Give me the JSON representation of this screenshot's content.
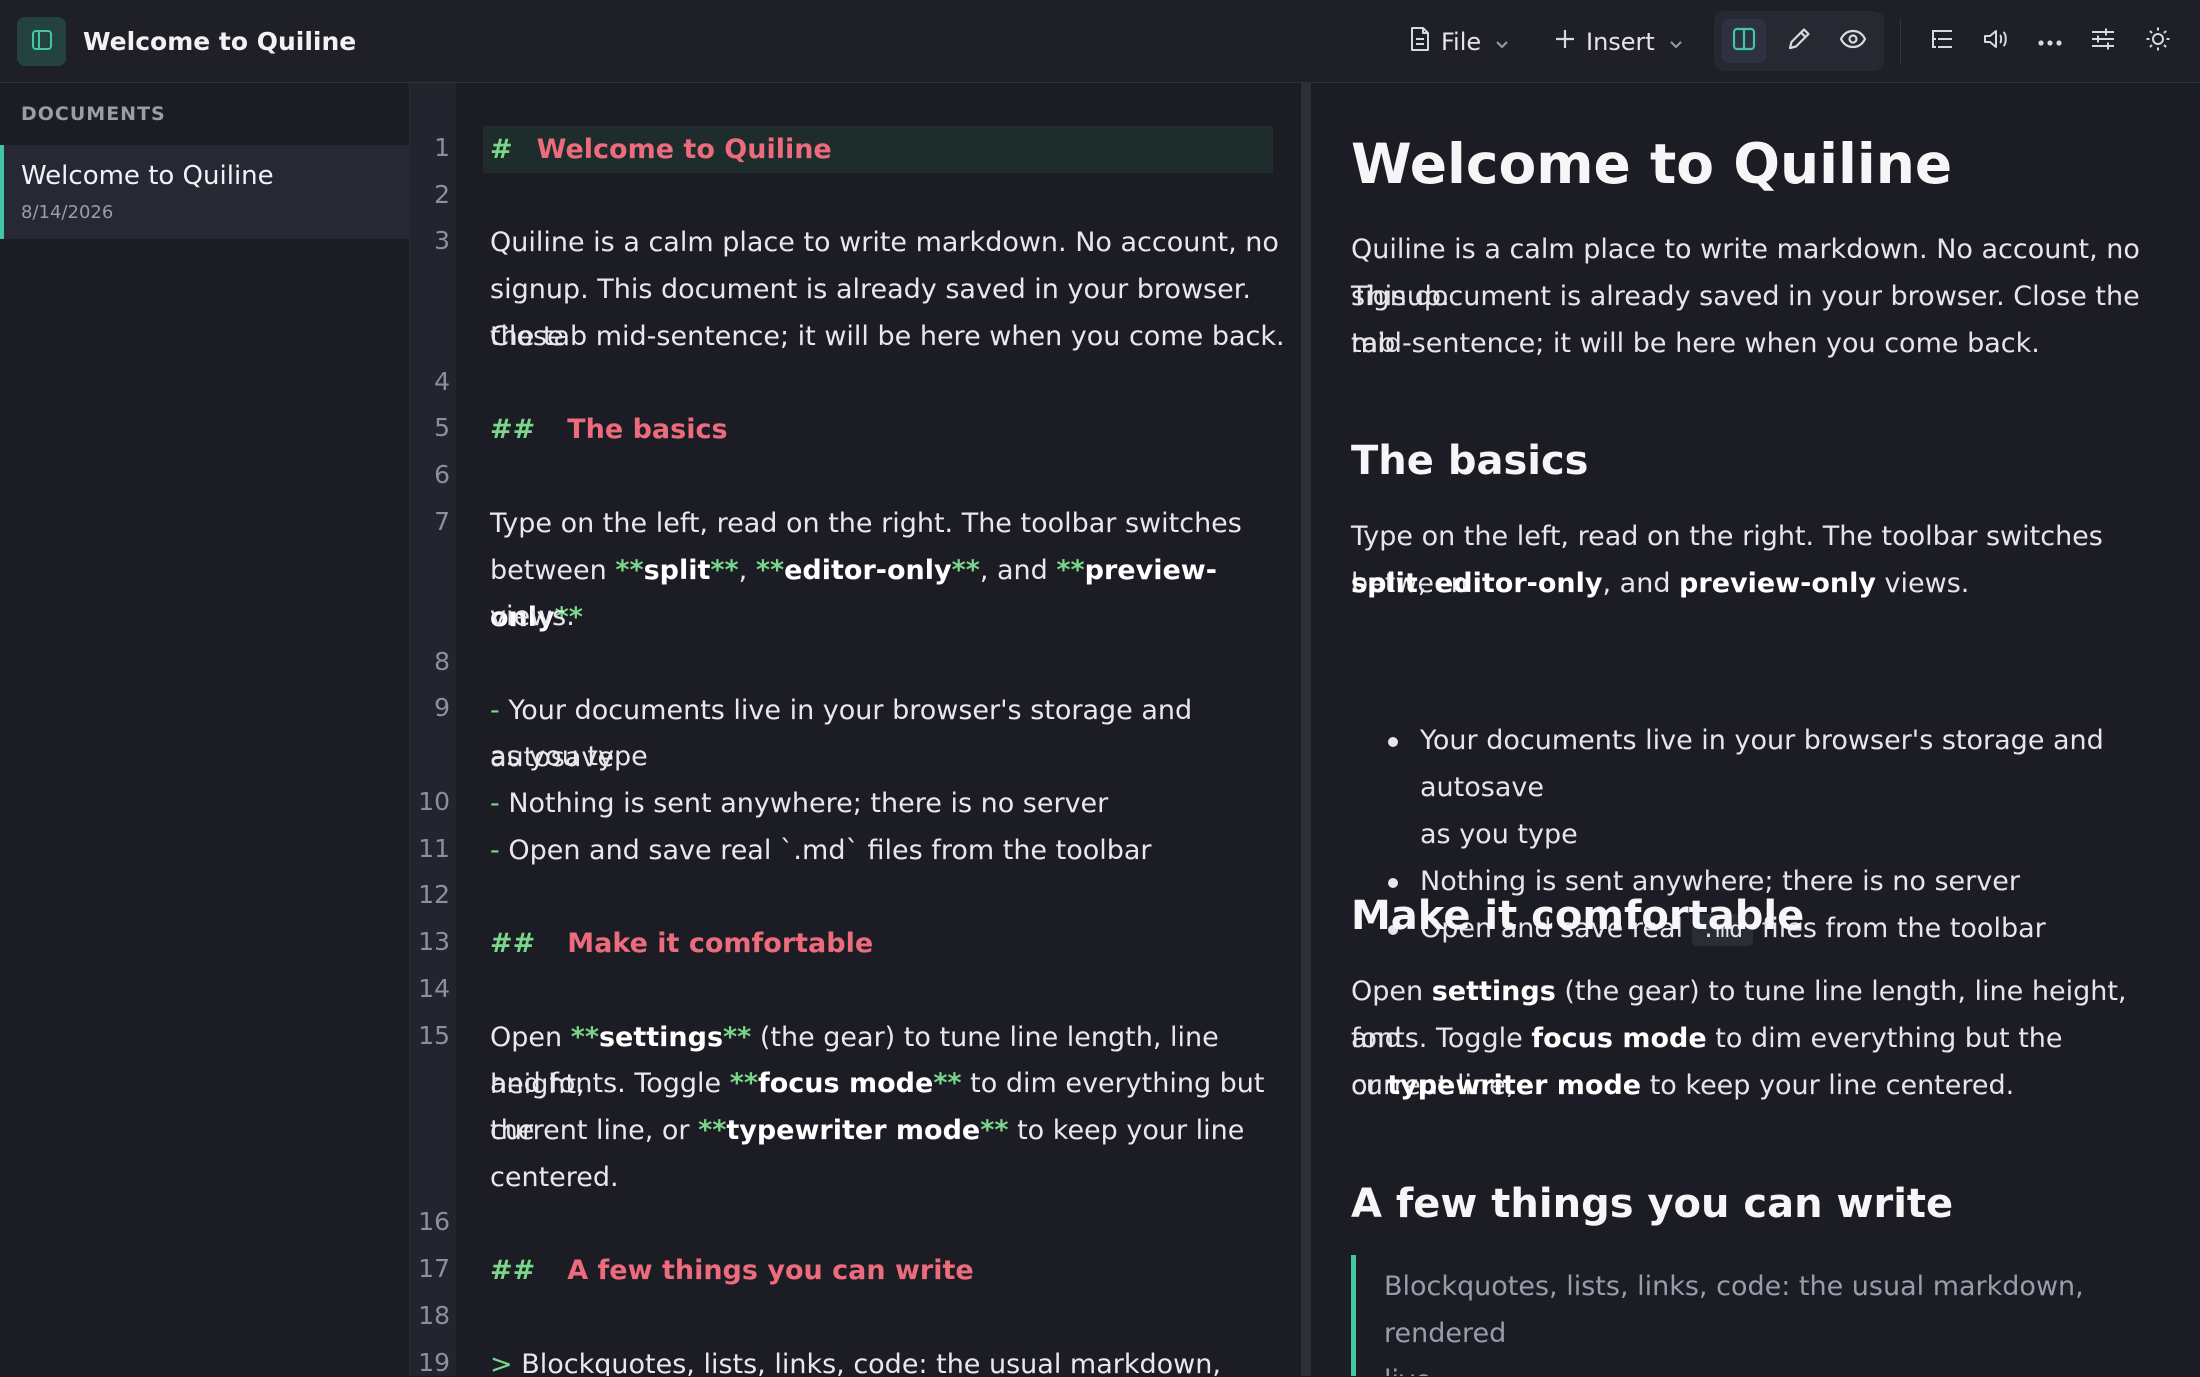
{
  "app": {
    "title": "Welcome to Quiline",
    "accent_color": "#42c6a3"
  },
  "toolbar": {
    "file_label": "File",
    "insert_label": "Insert",
    "icons": [
      "sidebar-toggle-icon",
      "file-icon",
      "plus-icon",
      "split-view-icon",
      "edit-icon",
      "eye-icon",
      "outline-icon",
      "speaker-icon",
      "more-icon",
      "sliders-icon",
      "sun-icon"
    ]
  },
  "sidebar": {
    "heading": "DOCUMENTS",
    "documents": [
      {
        "title": "Welcome to Quiline",
        "date": "8/14/2026"
      }
    ]
  },
  "editor": {
    "line_numbers": [
      "1",
      "2",
      "3",
      "4",
      "5",
      "6",
      "7",
      "8",
      "9",
      "10",
      "11",
      "12",
      "13",
      "14",
      "15",
      "16",
      "17",
      "18",
      "19"
    ],
    "lines": {
      "l1_mark": "#",
      "l1_heading": "Welcome to Quiline",
      "l3": "Quiline is a calm place to write markdown. No account, no",
      "l3b": "signup. This document is already saved in your browser. Close",
      "l3c": "the tab mid-sentence; it will be here when you come back.",
      "l5_mark": "##",
      "l5_heading": "The basics",
      "l7a": "Type on the left, read on the right. The toolbar switches",
      "l7b_pre": "between ",
      "l7b_bold1": "split",
      "l7b_mid1": ", ",
      "l7b_bold2": "editor-only",
      "l7b_mid2": ", and ",
      "l7b_bold3": "preview-only",
      "l7c": "views.",
      "l9_mark": "- ",
      "l9a": "Your documents live in your browser's storage and autosave",
      "l9b": "as you type",
      "l10_mark": "- ",
      "l10": "Nothing is sent anywhere; there is no server",
      "l11_mark": "- ",
      "l11": "Open and save real `.md` files from the toolbar",
      "l13_mark": "##",
      "l13_heading": "Make it comfortable",
      "l15a_pre": "Open ",
      "l15a_bold": "settings",
      "l15a_post": " (the gear) to tune line length, line height,",
      "l15b_pre": "and fonts. Toggle ",
      "l15b_bold": "focus mode",
      "l15b_post": " to dim everything but the",
      "l15c_pre": "current line, or ",
      "l15c_bold": "typewriter mode",
      "l15c_post": " to keep your line",
      "l15d": "centered.",
      "l17_mark": "##",
      "l17_heading": "A few things you can write",
      "l19_mark": "> ",
      "l19": "Blockquotes, lists, links, code: the usual markdown, rendered",
      "bold_marker": "**"
    }
  },
  "preview": {
    "h1": "Welcome to Quiline",
    "p1a": "Quiline is a calm place to write markdown. No account, no signup.",
    "p1b": "This document is already saved in your browser. Close the tab",
    "p1c": "mid-sentence; it will be here when you come back.",
    "h2_basics": "The basics",
    "p2a": "Type on the left, read on the right. The toolbar switches between",
    "p2b_bold1": "split",
    "p2b_mid1": ", ",
    "p2b_bold2": "editor-only",
    "p2b_mid2": ", and ",
    "p2b_bold3": "preview-only",
    "p2b_post": " views.",
    "list1a": "Your documents live in your browser's storage and autosave",
    "list1b": "as you type",
    "list2": "Nothing is sent anywhere; there is no server",
    "list3_pre": "Open and save real ",
    "list3_code": ".md",
    "list3_post": " files from the toolbar",
    "h2_comfortable": "Make it comfortable",
    "p3a_pre": "Open ",
    "p3a_bold": "settings",
    "p3a_post": " (the gear) to tune line length, line height, and",
    "p3b_pre": "fonts. Toggle ",
    "p3b_bold": "focus mode",
    "p3b_post": " to dim everything but the current line,",
    "p3c_pre": "or ",
    "p3c_bold": "typewriter mode",
    "p3c_post": " to keep your line centered.",
    "h2_things": "A few things you can write",
    "quote_a": "Blockquotes, lists, links, code: the usual markdown, rendered",
    "quote_b": "live."
  }
}
